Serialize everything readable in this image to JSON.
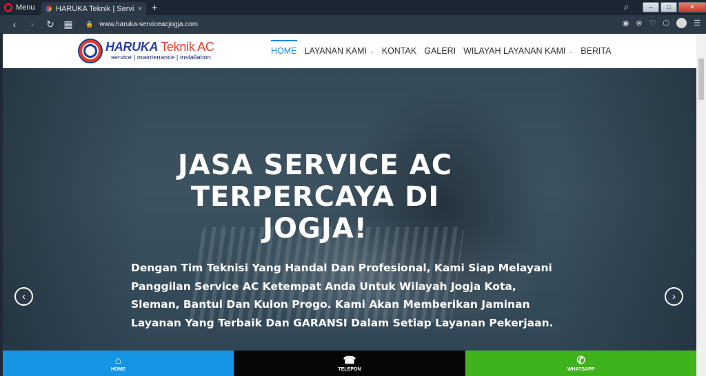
{
  "browser": {
    "menu_label": "Menu",
    "tab_title": "HARUKA Teknik | Service AC",
    "tab_close": "×",
    "new_tab": "+",
    "url": "www.haruka-serviceacjogja.com",
    "window_buttons": {
      "minimize": "–",
      "maximize": "□",
      "close": "✕"
    }
  },
  "site": {
    "logo": {
      "brand": "HARUKA",
      "sub": "Teknik AC",
      "tagline": "service | maintenance | installation"
    },
    "menu": [
      {
        "label": "HOME",
        "active": true,
        "has_dropdown": false
      },
      {
        "label": "LAYANAN KAMI",
        "active": false,
        "has_dropdown": true
      },
      {
        "label": "KONTAK",
        "active": false,
        "has_dropdown": false
      },
      {
        "label": "GALERI",
        "active": false,
        "has_dropdown": false
      },
      {
        "label": "WILAYAH LAYANAN KAMI",
        "active": false,
        "has_dropdown": true
      },
      {
        "label": "BERITA",
        "active": false,
        "has_dropdown": false
      }
    ],
    "hero": {
      "title": "JASA SERVICE AC TERPERCAYA DI JOGJA!",
      "description": "Dengan Tim Teknisi Yang Handal Dan Profesional, Kami Siap Melayani Panggilan Service AC Ketempat Anda Untuk Wilayah Jogja Kota, Sleman, Bantul Dan Kulon Progo. Kami Akan Memberikan Jaminan Layanan Yang Terbaik Dan GARANSI Dalam Setiap Layanan Pekerjaan."
    },
    "bottom_bar": [
      {
        "label": "HOME",
        "icon": "home-icon"
      },
      {
        "label": "TELEPON",
        "icon": "phone-icon"
      },
      {
        "label": "WHATSAPP",
        "icon": "whatsapp-icon"
      }
    ]
  },
  "colors": {
    "accent": "#1e88e5",
    "brand_blue": "#2a3fa8",
    "brand_red": "#e83c2a",
    "home_bar": "#1595e3",
    "telepon_bar": "#060606",
    "whatsapp_bar": "#3fb31c"
  }
}
